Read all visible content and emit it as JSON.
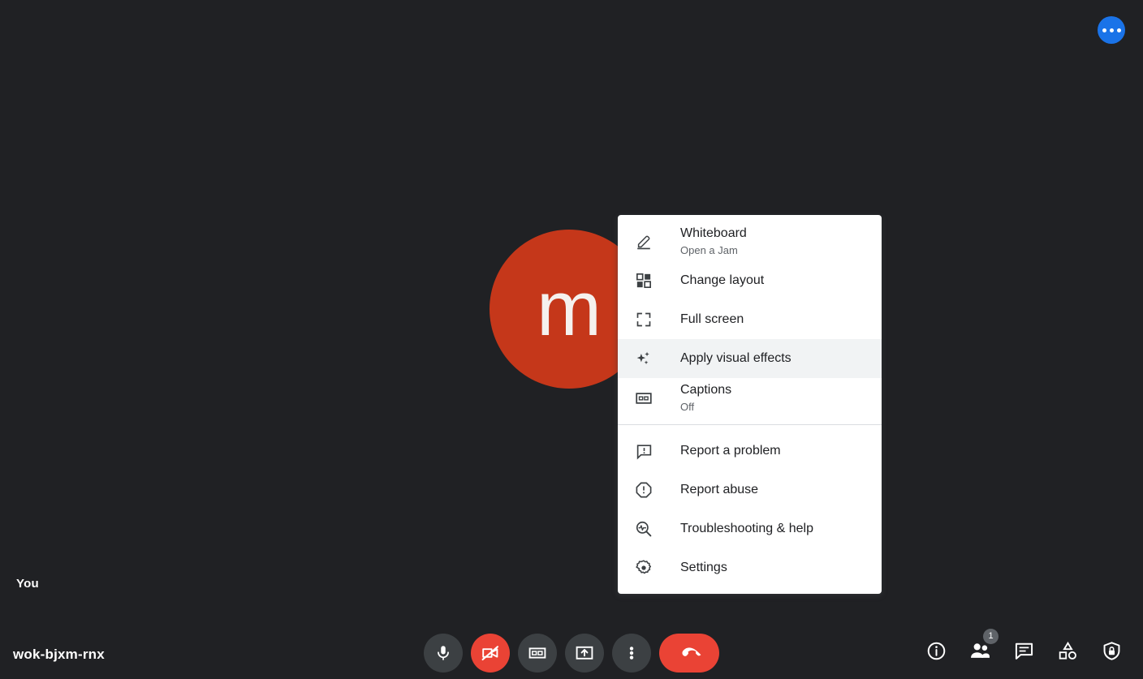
{
  "meeting": {
    "code": "wok-bjxm-rnx",
    "self_label": "You",
    "avatar_initial": "m",
    "avatar_color": "#c5371a"
  },
  "top_bar": {
    "more_options_label": "More options"
  },
  "menu": {
    "groups": [
      {
        "items": [
          {
            "label": "Whiteboard",
            "sub": "Open a Jam",
            "icon": "whiteboard-icon"
          },
          {
            "label": "Change layout",
            "sub": "",
            "icon": "layout-icon"
          },
          {
            "label": "Full screen",
            "sub": "",
            "icon": "fullscreen-icon"
          },
          {
            "label": "Apply visual effects",
            "sub": "",
            "icon": "sparkle-icon",
            "highlighted": true
          },
          {
            "label": "Captions",
            "sub": "Off",
            "icon": "captions-icon"
          }
        ]
      },
      {
        "items": [
          {
            "label": "Report a problem",
            "sub": "",
            "icon": "report-problem-icon"
          },
          {
            "label": "Report abuse",
            "sub": "",
            "icon": "report-abuse-icon"
          },
          {
            "label": "Troubleshooting & help",
            "sub": "",
            "icon": "troubleshooting-icon"
          },
          {
            "label": "Settings",
            "sub": "",
            "icon": "settings-gear-icon"
          }
        ]
      }
    ]
  },
  "controls": {
    "center": [
      {
        "name": "microphone-button",
        "label": "Turn off microphone",
        "state": "on"
      },
      {
        "name": "camera-button",
        "label": "Turn on camera",
        "state": "off"
      },
      {
        "name": "captions-button",
        "label": "Turn on captions",
        "state": "off"
      },
      {
        "name": "present-screen-button",
        "label": "Present now",
        "state": "off"
      },
      {
        "name": "more-options-button",
        "label": "More options",
        "state": "active"
      },
      {
        "name": "leave-call-button",
        "label": "Leave call",
        "state": "danger"
      }
    ],
    "right": [
      {
        "name": "meeting-details-button",
        "label": "Meeting details",
        "badge": ""
      },
      {
        "name": "people-button",
        "label": "Show everyone",
        "badge": "1"
      },
      {
        "name": "chat-button",
        "label": "Chat with everyone",
        "badge": ""
      },
      {
        "name": "activities-button",
        "label": "Activities",
        "badge": ""
      },
      {
        "name": "host-controls-button",
        "label": "Host controls",
        "badge": ""
      }
    ]
  },
  "colors": {
    "background": "#202124",
    "accent_blue": "#1a73e8",
    "danger_red": "#ea4335",
    "control_grey": "#3c4043",
    "menu_background": "#ffffff",
    "menu_highlight": "#f1f3f4"
  }
}
